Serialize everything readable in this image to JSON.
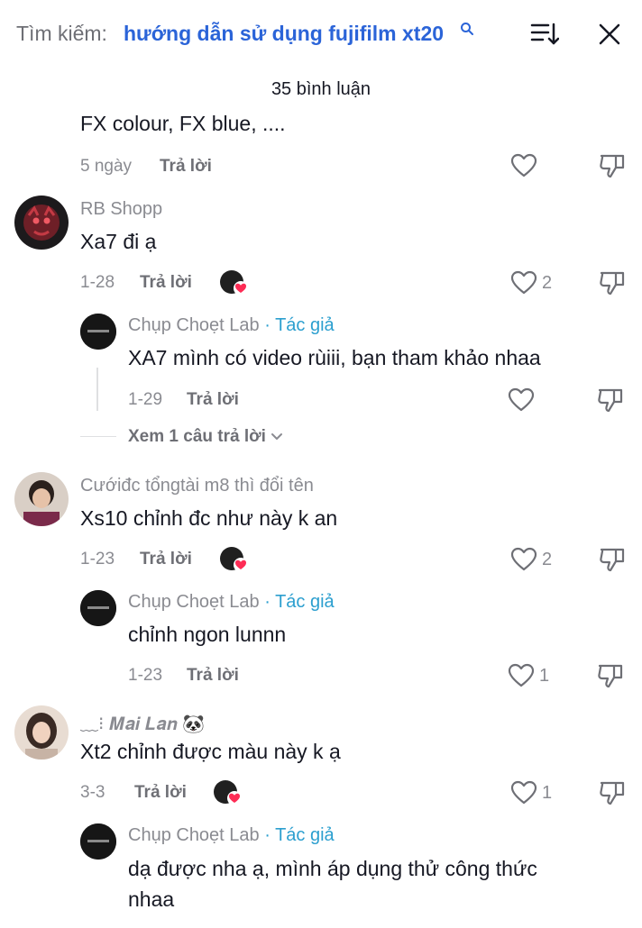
{
  "header": {
    "search_label": "Tìm kiếm:",
    "search_query": "hướng dẫn sử dụng fujifilm xt20",
    "comment_count": "35 bình luận"
  },
  "colors": {
    "accent_blue": "#2b64d8",
    "author_badge": "#2c9fcf",
    "heart_red": "#fe2c55",
    "muted": "#8a8b91"
  },
  "comments": [
    {
      "text": "FX colour, FX blue, ....",
      "date": "5 ngày",
      "reply_label": "Trả lời"
    },
    {
      "author": "RB Shopp",
      "text": "Xa7 đi ạ",
      "date": "1-28",
      "reply_label": "Trả lời",
      "likes": "2"
    },
    {
      "author": "Chụp Choẹt Lab",
      "badge": "· Tác giả",
      "text": "XA7 mình có video rùiii, bạn tham khảo nhaa",
      "date": "1-29",
      "reply_label": "Trả lời",
      "view_more": "Xem 1 câu trả lời"
    },
    {
      "author": "Cướiđc tổngtài m8 thì đổi tên",
      "text": "Xs10 chỉnh đc như này k an",
      "date": "1-23",
      "reply_label": "Trả lời",
      "likes": "2"
    },
    {
      "author": "Chụp Choẹt Lab",
      "badge": "· Tác giả",
      "text": "chỉnh ngon lunnn",
      "date": "1-23",
      "reply_label": "Trả lời",
      "likes": "1"
    },
    {
      "author": "﹏⁝ 𝑴𝒂𝒊 𝑳𝒂𝒏 🐼",
      "text": "Xt2 chỉnh được màu này k ạ",
      "date": "3-3",
      "reply_label": "Trả lời",
      "likes": "1"
    },
    {
      "author": "Chụp Choẹt Lab",
      "badge": "· Tác giả",
      "text_line1": "dạ được nha ạ, mình áp dụng thử công thức",
      "text_line2": "nhaa"
    }
  ]
}
